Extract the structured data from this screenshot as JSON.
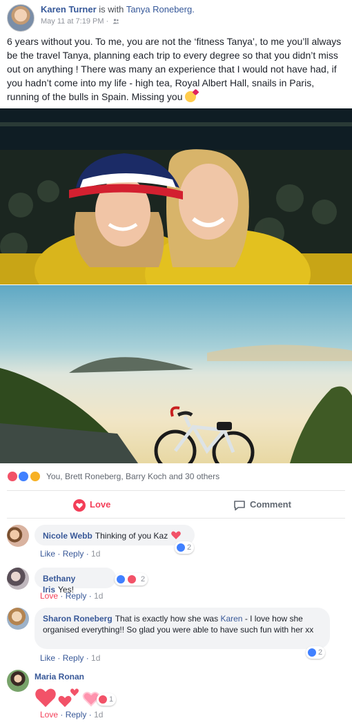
{
  "post": {
    "author": "Karen Turner",
    "with_text": "is with",
    "tagged": "Tanya Roneberg.",
    "timestamp": "May 11 at 7:19 PM",
    "separator": "·",
    "audience_icon": "friends-icon",
    "text": "6 years without you. To me, you are not the ‘fitness Tanya’, to me you’ll always be the travel Tanya, planning each trip to every degree so that you didn’t miss out on anything ! There was many an experience that I would not have had, if you hadn’t come into my life - high tea, Royal Albert Hall, snails in Paris, running of the bulls in Spain. Missing you",
    "text_emoji": "kissing-face-emoji"
  },
  "photos": [
    {
      "alt_icon": "photo-two-women-icon"
    },
    {
      "alt_icon": "photo-bike-landscape-icon"
    }
  ],
  "reactions_summary": {
    "text": "You, Brett Roneberg, Barry Koch and 30 others",
    "icons": [
      "love",
      "like",
      "sad"
    ]
  },
  "actions": {
    "love_label": "Love",
    "comment_label": "Comment"
  },
  "colors": {
    "link": "#365899",
    "love": "#f33e58",
    "like": "#4080ff",
    "meta": "#90949c",
    "bubble": "#f2f3f5"
  },
  "comments": [
    {
      "name": "Nicole Webb",
      "text": "Thinking of you Kaz",
      "emoji": "heart-emoji",
      "actions": [
        "Like",
        "Reply"
      ],
      "time": "1d",
      "reaction_count": "2",
      "reaction_icon": "like"
    },
    {
      "name": "Bethany Iris",
      "text": "Yes!",
      "actions": [
        "Love",
        "Reply"
      ],
      "time": "1d",
      "reaction_count": "2",
      "reaction_icon": "like,love"
    },
    {
      "name": "Sharon Roneberg",
      "text_before": "That is exactly how she was",
      "mention": "Karen",
      "text_after": "- I love how she organised everything!! So glad you were able to have such fun with her xx",
      "actions": [
        "Like",
        "Reply"
      ],
      "time": "1d",
      "reaction_count": "2",
      "reaction_icon": "like"
    },
    {
      "name": "Maria Ronan",
      "sticker": "hearts-sticker",
      "actions": [
        "Love",
        "Reply"
      ],
      "time": "1d",
      "reaction_count": "1",
      "reaction_icon": "love"
    }
  ]
}
